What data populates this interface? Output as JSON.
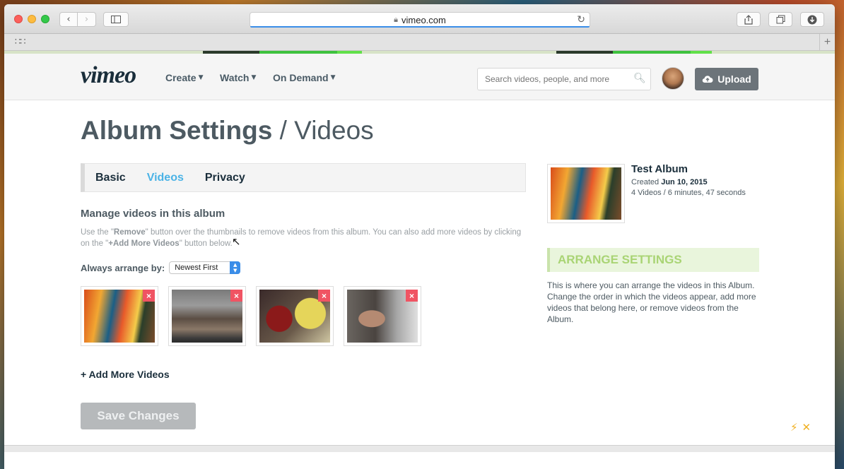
{
  "browser": {
    "url": "vimeo.com",
    "icons": {
      "back": "chevron-left-icon",
      "forward": "chevron-right-icon",
      "sidebar": "sidebar-icon",
      "share": "share-icon",
      "tabs": "tabs-icon",
      "download": "download-icon",
      "reload": "reload-icon",
      "lock": "lock-icon"
    }
  },
  "header": {
    "logo": "vimeo",
    "nav": [
      {
        "label": "Create"
      },
      {
        "label": "Watch"
      },
      {
        "label": "On Demand"
      }
    ],
    "search_placeholder": "Search videos, people, and more",
    "upload_label": "Upload"
  },
  "page": {
    "title_strong": "Album Settings",
    "title_light": " / Videos",
    "tabs": [
      {
        "label": "Basic",
        "active": false
      },
      {
        "label": "Videos",
        "active": true
      },
      {
        "label": "Privacy",
        "active": false
      }
    ],
    "section_heading": "Manage videos in this album",
    "help": {
      "part1": "Use the \"",
      "remove": "Remove",
      "part2": "\" button over the thumbnails to remove videos from this album. You can also add more videos by clicking on the \"",
      "add": "+Add More Videos",
      "part3": "\" button below."
    },
    "arrange_label": "Always arrange by:",
    "arrange_value": "Newest First",
    "thumbnails": [
      {
        "remove": "×"
      },
      {
        "remove": "×"
      },
      {
        "remove": "×"
      },
      {
        "remove": "×"
      }
    ],
    "add_more": "+ Add More Videos",
    "save_label": "Save Changes"
  },
  "sidebar": {
    "album_title": "Test Album",
    "created_prefix": "Created ",
    "created_date": "Jun 10, 2015",
    "stats": "4 Videos / 6 minutes, 47 seconds",
    "arrange_heading": "ARRANGE SETTINGS",
    "arrange_desc": "This is where you can arrange the videos in this Album. Change the order in which the videos appear, add more videos that belong here, or remove videos from the Album."
  },
  "colors": {
    "accent": "#4bb3e6",
    "remove": "#f05463",
    "arrange_green": "#a9d474",
    "upload_bg": "#6c747a"
  }
}
